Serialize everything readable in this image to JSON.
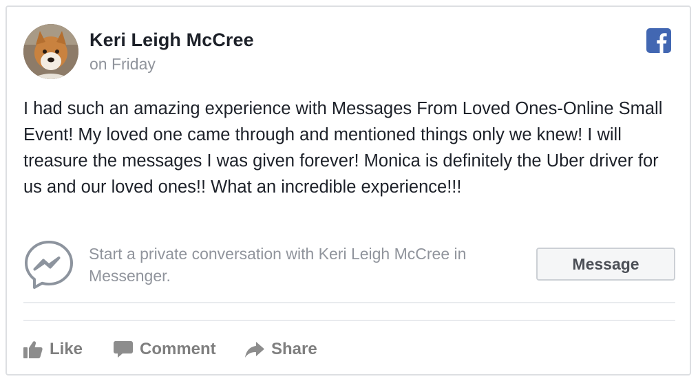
{
  "post": {
    "author": "Keri Leigh McCree",
    "time": "on Friday",
    "text": "I had such an amazing experience with Messages From Loved Ones-Online Small Event! My loved one came through and mentioned things only we knew! I will treasure the messages I was given forever! Monica is definitely the Uber driver for us and our loved ones!! What an incredible experience!!!"
  },
  "messenger": {
    "prompt": "Start a private conversation with Keri Leigh McCree in Messenger.",
    "button_label": "Message"
  },
  "actions": {
    "like": "Like",
    "comment": "Comment",
    "share": "Share"
  },
  "icons": {
    "brand": "facebook-logo-icon",
    "messenger": "messenger-icon",
    "like": "thumbs-up-icon",
    "comment": "speech-bubble-icon",
    "share": "share-arrow-icon"
  },
  "colors": {
    "facebook_blue": "#4267b2",
    "author_text": "#1d2129",
    "muted_text": "#90949c",
    "action_text": "#7f7f7f",
    "border": "#dddfe2"
  }
}
